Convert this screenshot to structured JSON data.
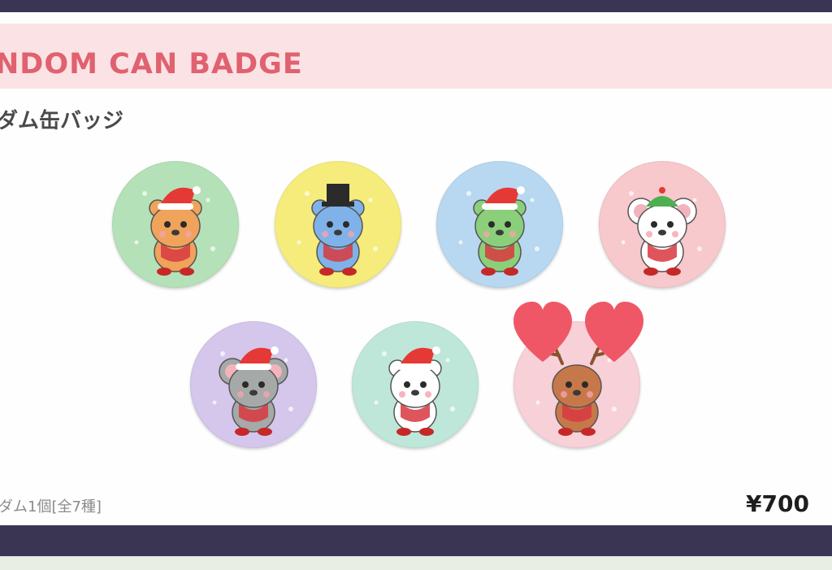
{
  "header": {
    "title": "NDOM CAN BADGE"
  },
  "subtitle": "ダム缶バッジ",
  "badges": [
    {
      "character": "tiger",
      "color": "#b5e1b8"
    },
    {
      "character": "bear",
      "color": "#f5ec7c"
    },
    {
      "character": "dog",
      "color": "#b7d8f0"
    },
    {
      "character": "mouse",
      "color": "#f7c8cc"
    },
    {
      "character": "koala",
      "color": "#d5c6ec"
    },
    {
      "character": "polar-bear",
      "color": "#bfe7d9"
    },
    {
      "character": "reindeer",
      "color": "#f7d0d8"
    }
  ],
  "footer": {
    "note": "ダム1個[全7種]",
    "price": "¥700"
  },
  "colors": {
    "accent": "#e0616f",
    "frame": "#3a3552",
    "title_band": "#fbe2e4",
    "heart": "#ef5767"
  }
}
